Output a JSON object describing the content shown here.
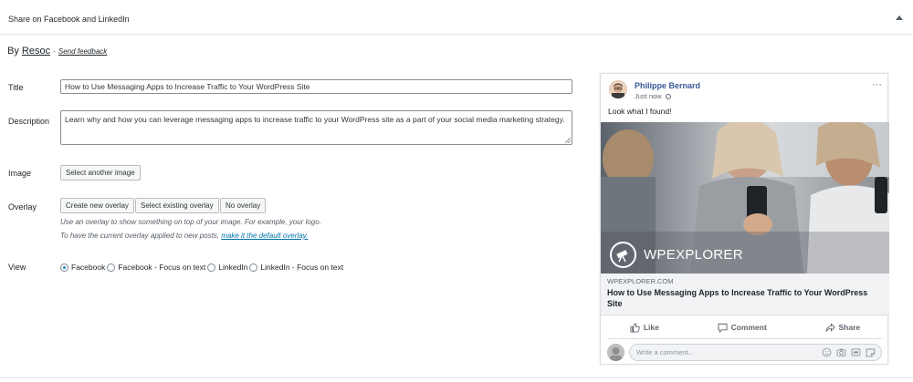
{
  "panel": {
    "title": "Share on Facebook and LinkedIn"
  },
  "byline": {
    "by": "By",
    "brand": "Resoc",
    "separator": "-",
    "feedback": "Send feedback"
  },
  "form": {
    "title_label": "Title",
    "title_value": "How to Use Messaging Apps to Increase Traffic to Your WordPress Site",
    "description_label": "Description",
    "description_value": "Learn why and how you can leverage messaging apps to increase traffic to your WordPress site as a part of your social media marketing strategy.",
    "image_label": "Image",
    "image_button": "Select another image",
    "overlay_label": "Overlay",
    "overlay_buttons": [
      "Create new overlay",
      "Select existing overlay",
      "No overlay"
    ],
    "overlay_help_1": "Use an overlay to show something on top of your image. For example, your logo.",
    "overlay_help_2_prefix": "To have the current overlay applied to new posts,",
    "overlay_help_2_link": "make it the default overlay.",
    "view_label": "View",
    "view_options": [
      "Facebook",
      "Facebook - Focus on text",
      "LinkedIn",
      "LinkedIn - Focus on text"
    ],
    "view_selected": "Facebook"
  },
  "preview": {
    "author": "Philippe Bernard",
    "time": "Just now",
    "more": "···",
    "message": "Look what I found!",
    "image_brand": "WPEXPLORER",
    "domain": "WPEXPLORER.COM",
    "link_title": "How to Use Messaging Apps to Increase Traffic to Your WordPress Site",
    "actions": [
      "Like",
      "Comment",
      "Share"
    ],
    "comment_placeholder": "Write a comment..."
  },
  "colors": {
    "link_blue": "#0073aa",
    "fb_name": "#385898",
    "radio_accent": "#1e8cbe"
  }
}
